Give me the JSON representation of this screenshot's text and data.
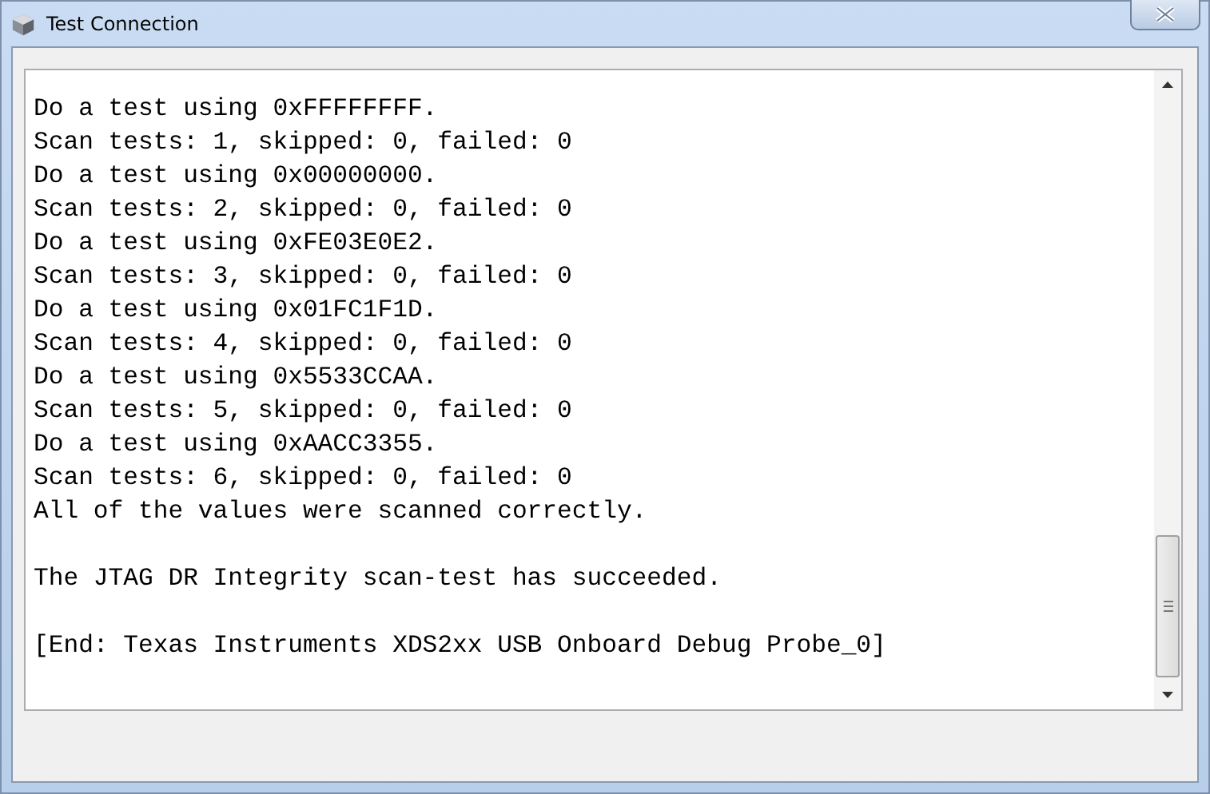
{
  "window": {
    "title": "Test Connection"
  },
  "log": {
    "blocks": [
      [
        "Do a test using 0xFFFFFFFF.",
        "Scan tests: 1, skipped: 0, failed: 0",
        "Do a test using 0x00000000.",
        "Scan tests: 2, skipped: 0, failed: 0",
        "Do a test using 0xFE03E0E2.",
        "Scan tests: 3, skipped: 0, failed: 0",
        "Do a test using 0x01FC1F1D.",
        "Scan tests: 4, skipped: 0, failed: 0",
        "Do a test using 0x5533CCAA.",
        "Scan tests: 5, skipped: 0, failed: 0",
        "Do a test using 0xAACC3355.",
        "Scan tests: 6, skipped: 0, failed: 0",
        "All of the values were scanned correctly."
      ],
      [
        "The JTAG DR Integrity scan-test has succeeded."
      ],
      [
        "[End: Texas Instruments XDS2xx USB Onboard Debug Probe_0]"
      ]
    ]
  }
}
